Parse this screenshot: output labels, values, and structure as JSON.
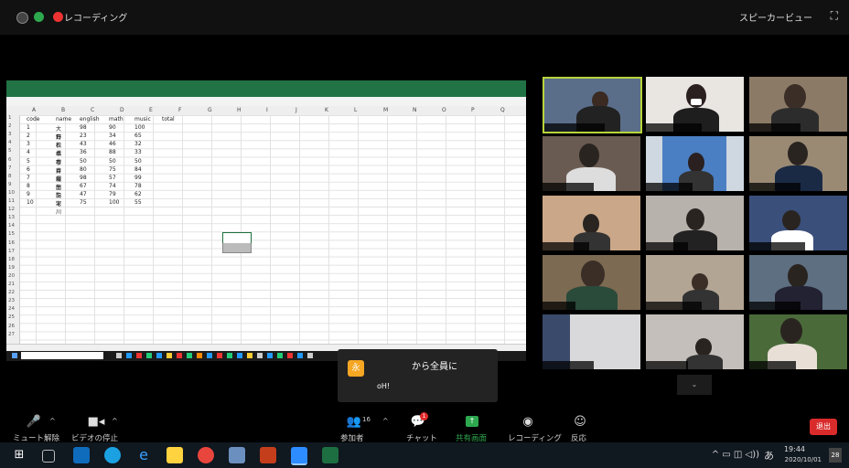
{
  "topbar": {
    "recording_label": "レコーディング",
    "speaker_view_label": "スピーカービュー",
    "fullscreen_icon": "⛶"
  },
  "spreadsheet": {
    "columns": [
      "A",
      "B",
      "C",
      "D",
      "E",
      "F",
      "G",
      "H",
      "I",
      "J",
      "K",
      "L",
      "M",
      "N",
      "O",
      "P",
      "Q"
    ],
    "headers": [
      "code",
      "name",
      "english",
      "math",
      "music",
      "total"
    ],
    "rows": [
      [
        "1",
        "大野",
        "98",
        "90",
        "100"
      ],
      [
        "2",
        "白石",
        "23",
        "34",
        "65"
      ],
      [
        "3",
        "松本",
        "43",
        "46",
        "32"
      ],
      [
        "4",
        "橋本",
        "36",
        "88",
        "33"
      ],
      [
        "5",
        "櫻井",
        "50",
        "50",
        "50"
      ],
      [
        "6",
        "齋藤",
        "80",
        "75",
        "84"
      ],
      [
        "7",
        "堀田",
        "98",
        "57",
        "99"
      ],
      [
        "8",
        "生駒",
        "67",
        "74",
        "78"
      ],
      [
        "9",
        "三宅",
        "47",
        "79",
        "62"
      ],
      [
        "10",
        "深川",
        "75",
        "100",
        "55"
      ]
    ]
  },
  "chat_popup": {
    "avatar_letter": "永",
    "from_label": "から全員に",
    "message": "oH!"
  },
  "toolbar": {
    "mute_label": "ミュート解除",
    "video_label": "ビデオの停止",
    "participants_label": "参加者",
    "participants_count": "16",
    "chat_label": "チャット",
    "chat_badge": "1",
    "share_label": "共有画面",
    "record_label": "レコーディング",
    "reactions_label": "反応",
    "end_label": "退出"
  },
  "taskbar": {
    "time": "19:44",
    "date": "2020/10/01",
    "ime": "あ",
    "notifications": "28"
  }
}
